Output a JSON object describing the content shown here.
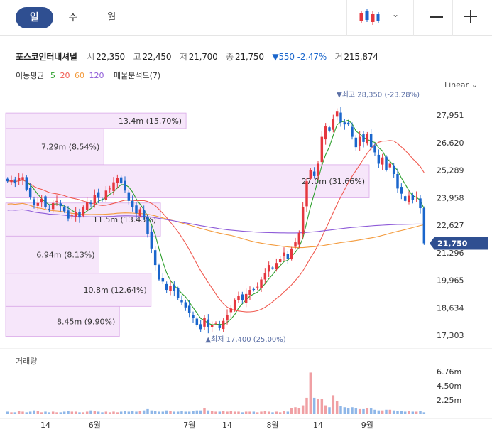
{
  "period_tabs": [
    "일",
    "주",
    "월"
  ],
  "active_period": "일",
  "quote": {
    "name": "포스코인터내셔널",
    "open_label": "시",
    "open": "22,350",
    "high_label": "고",
    "high": "22,450",
    "low_label": "저",
    "low": "21,700",
    "close_label": "종",
    "close": "21,750",
    "change": "▼550",
    "change_pct": "-2.47%",
    "volume_label": "거",
    "volume": "215,874"
  },
  "ma_legend": {
    "label": "이동평균",
    "periods": [
      "5",
      "20",
      "60",
      "120"
    ],
    "colors": [
      "#2ea02e",
      "#f05a50",
      "#f39a3b",
      "#8e5bd8"
    ],
    "profile_label": "매물분석도(7)"
  },
  "scale_button": "Linear",
  "volume_title": "거래량",
  "colors": {
    "up": "#e5373f",
    "down": "#1a66cc",
    "profile": "#f6e6fa",
    "profile_border": "#d9a8e8",
    "marker": "#5b6fa5"
  },
  "chart_data": {
    "type": "candlestick",
    "y_ticks": [
      "27,951",
      "26,620",
      "25,289",
      "23,958",
      "22,627",
      "21,296",
      "19,965",
      "18,634",
      "17,303"
    ],
    "y_tick_values": [
      27951,
      26620,
      25289,
      23958,
      22627,
      21296,
      19965,
      18634,
      17303
    ],
    "x_ticks": [
      "14",
      "6월",
      "7월",
      "14",
      "8월",
      "14",
      "9월"
    ],
    "x_tick_index": [
      10,
      23,
      48,
      58,
      70,
      82,
      95
    ],
    "last_price": "21,750",
    "last_price_value": 21750,
    "high_marker": "▼최고 28,350 (-23.28%)",
    "high_value": 28350,
    "high_index": 88,
    "low_marker": "▲최저 17,400 (25.00%)",
    "low_value": 17400,
    "low_index": 53,
    "volume_ticks": [
      "6.76m",
      "4.50m",
      "2.25m"
    ],
    "volume_tick_values": [
      6760000,
      4500000,
      2250000
    ],
    "volume_profile": [
      {
        "label": "13.4m (15.70%)",
        "value": 13.4,
        "low": 27300,
        "high": 28050
      },
      {
        "label": "7.29m (8.54%)",
        "value": 7.29,
        "low": 25550,
        "high": 27300
      },
      {
        "label": "27.0m (31.66%)",
        "value": 27.0,
        "low": 23950,
        "high": 25550
      },
      {
        "label": "11.5m (13.43%)",
        "value": 11.5,
        "low": 22100,
        "high": 23700
      },
      {
        "label": "6.94m (8.13%)",
        "value": 6.94,
        "low": 20300,
        "high": 22100
      },
      {
        "label": "10.8m (12.64%)",
        "value": 10.8,
        "low": 18700,
        "high": 20300
      },
      {
        "label": "8.45m (9.90%)",
        "value": 8.45,
        "low": 17250,
        "high": 18700
      }
    ],
    "closes": [
      24750,
      24800,
      24650,
      24900,
      24950,
      24350,
      24000,
      23600,
      23700,
      23900,
      23500,
      23400,
      23700,
      23800,
      23550,
      23300,
      22950,
      23100,
      23250,
      23000,
      23500,
      23750,
      23650,
      24100,
      23950,
      23850,
      24300,
      24400,
      24700,
      24900,
      24650,
      24300,
      23800,
      23500,
      23200,
      23400,
      23000,
      22200,
      21500,
      20700,
      20000,
      19900,
      19500,
      19700,
      19450,
      19100,
      18900,
      18650,
      18400,
      18150,
      17800,
      17600,
      18150,
      17700,
      17800,
      17900,
      17650,
      18000,
      18300,
      18600,
      19000,
      19200,
      19000,
      19300,
      19500,
      19500,
      19650,
      20000,
      20300,
      20700,
      20550,
      20800,
      21000,
      21300,
      21000,
      21500,
      21800,
      22250,
      23500,
      24750,
      25300,
      25000,
      25600,
      26900,
      27400,
      27200,
      27750,
      28150,
      27600,
      27500,
      27500,
      26900,
      26400,
      26900,
      26650,
      27050,
      26400,
      26150,
      25600,
      25900,
      25300,
      25600,
      25100,
      24400,
      24150,
      23800,
      24050,
      23850,
      24000,
      23450,
      21750
    ],
    "volumes": [
      0.4,
      0.3,
      0.3,
      0.5,
      0.4,
      0.3,
      0.4,
      0.6,
      0.5,
      0.3,
      0.4,
      0.3,
      0.4,
      0.3,
      0.3,
      0.4,
      0.5,
      0.4,
      0.4,
      0.3,
      0.3,
      0.4,
      0.6,
      0.5,
      0.4,
      0.3,
      0.4,
      0.3,
      0.4,
      0.3,
      0.4,
      0.5,
      0.4,
      0.5,
      0.4,
      0.5,
      0.6,
      0.8,
      0.6,
      0.5,
      0.4,
      0.4,
      0.6,
      0.5,
      0.4,
      0.4,
      0.5,
      0.4,
      0.4,
      0.5,
      0.6,
      0.6,
      0.9,
      0.6,
      0.5,
      0.4,
      0.4,
      0.5,
      0.4,
      0.5,
      0.4,
      0.4,
      0.3,
      0.4,
      0.4,
      0.4,
      0.3,
      0.4,
      0.5,
      0.4,
      0.3,
      0.4,
      0.3,
      0.5,
      0.4,
      1.0,
      1.1,
      1.0,
      1.4,
      2.6,
      6.6,
      2.6,
      2.4,
      2.4,
      1.4,
      1.1,
      3.0,
      2.1,
      1.3,
      1.1,
      0.9,
      1.1,
      0.9,
      0.8,
      0.8,
      0.9,
      0.9,
      0.7,
      0.6,
      0.6,
      0.7,
      0.7,
      0.6,
      0.5,
      0.5,
      0.4,
      0.5,
      0.4,
      0.4,
      0.5,
      0.3
    ]
  }
}
